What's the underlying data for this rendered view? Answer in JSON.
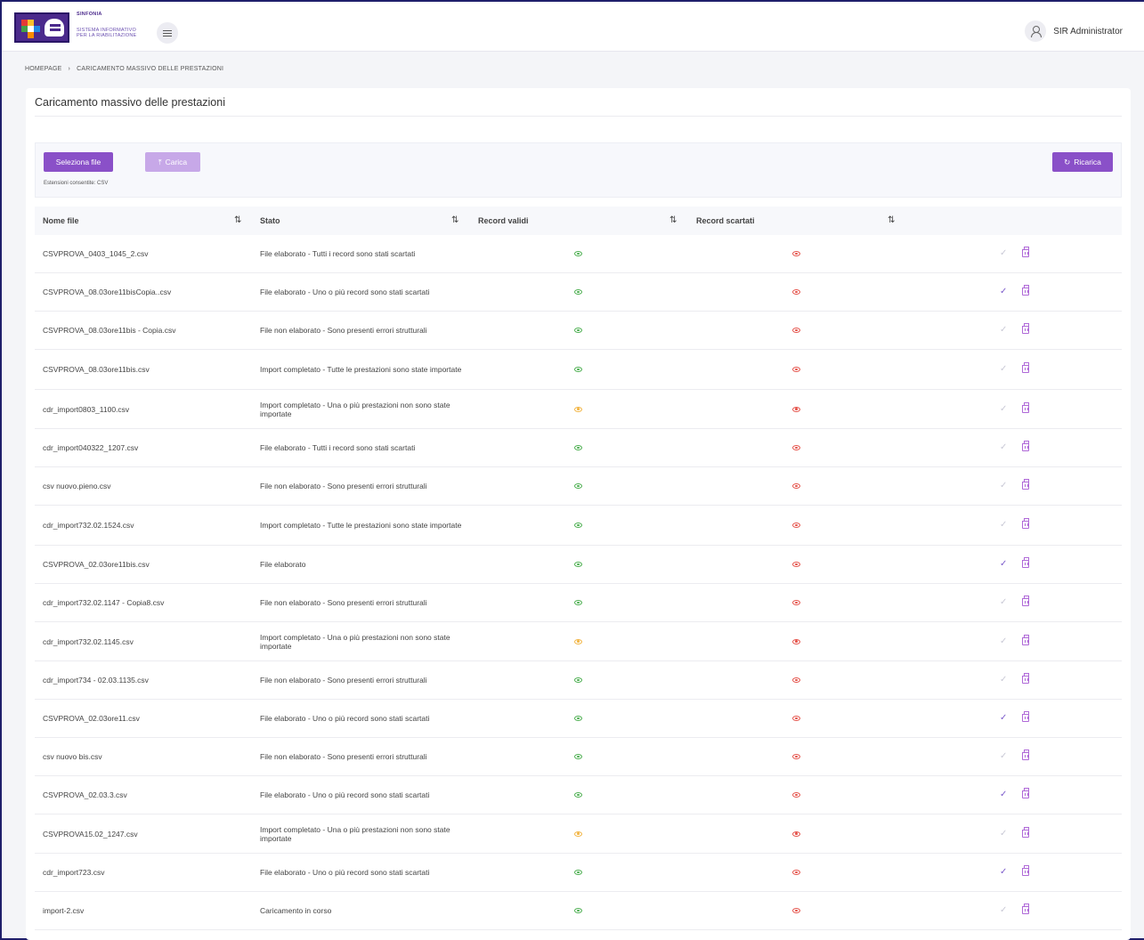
{
  "header": {
    "brand_title": "SINFONIA",
    "brand_subtitle_1": "SISTEMA INFORMATIVO",
    "brand_subtitle_2": "PER LA RIABILITAZIONE",
    "user_name": "SIR Administrator",
    "menu_icon": "hamburger-icon",
    "user_icon": "user-icon"
  },
  "breadcrumb": {
    "home": "HOMEPAGE",
    "separator": "›",
    "current": "CARICAMENTO MASSIVO DELLE PRESTAZIONI"
  },
  "page": {
    "title": "Caricamento massivo delle prestazioni"
  },
  "toolbar": {
    "select_label": "Seleziona file",
    "upload_label": "Carica",
    "upload_icon": "⤒",
    "reload_label": "Ricarica",
    "reload_icon": "↻",
    "extensions_text": "Estensioni consentite: CSV"
  },
  "table": {
    "headers": {
      "name": "Nome file",
      "status": "Stato",
      "valid": "Record validi",
      "discarded": "Record scartati",
      "sort_icon": "⇅"
    },
    "rows": [
      {
        "name": "CSVPROVA_0403_1045_2.csv",
        "status": "File elaborato - Tutti i record sono stati scartati",
        "valid_state": "ok",
        "confirmed": false
      },
      {
        "name": "CSVPROVA_08.03ore11bisCopia..csv",
        "status": "File elaborato - Uno o più record sono stati scartati",
        "valid_state": "ok",
        "confirmed": true
      },
      {
        "name": "CSVPROVA_08.03ore11bis - Copia.csv",
        "status": "File non elaborato - Sono presenti errori strutturali",
        "valid_state": "ok",
        "confirmed": false
      },
      {
        "name": "CSVPROVA_08.03ore11bis.csv",
        "status": "Import completato - Tutte le prestazioni sono state importate",
        "valid_state": "ok",
        "confirmed": false
      },
      {
        "name": "cdr_import0803_1100.csv",
        "status": "Import completato - Una o più prestazioni non sono state importate",
        "valid_state": "warn",
        "confirmed": false
      },
      {
        "name": "cdr_import040322_1207.csv",
        "status": "File elaborato - Tutti i record sono stati scartati",
        "valid_state": "ok",
        "confirmed": false
      },
      {
        "name": "csv nuovo.pieno.csv",
        "status": "File non elaborato - Sono presenti errori strutturali",
        "valid_state": "ok",
        "confirmed": false
      },
      {
        "name": "cdr_import732.02.1524.csv",
        "status": "Import completato - Tutte le prestazioni sono state importate",
        "valid_state": "ok",
        "confirmed": false
      },
      {
        "name": "CSVPROVA_02.03ore11bis.csv",
        "status": "File elaborato",
        "valid_state": "ok",
        "confirmed": true
      },
      {
        "name": "cdr_import732.02.1147 - Copia8.csv",
        "status": "File non elaborato - Sono presenti errori strutturali",
        "valid_state": "ok",
        "confirmed": false
      },
      {
        "name": "cdr_import732.02.1145.csv",
        "status": "Import completato - Una o più prestazioni non sono state importate",
        "valid_state": "warn",
        "confirmed": false
      },
      {
        "name": "cdr_import734 - 02.03.1135.csv",
        "status": "File non elaborato - Sono presenti errori strutturali",
        "valid_state": "ok",
        "confirmed": false
      },
      {
        "name": "CSVPROVA_02.03ore11.csv",
        "status": "File elaborato - Uno o più record sono stati scartati",
        "valid_state": "ok",
        "confirmed": true
      },
      {
        "name": "csv nuovo bis.csv",
        "status": "File non elaborato - Sono presenti errori strutturali",
        "valid_state": "ok",
        "confirmed": false
      },
      {
        "name": "CSVPROVA_02.03.3.csv",
        "status": "File elaborato - Uno o più record sono stati scartati",
        "valid_state": "ok",
        "confirmed": true
      },
      {
        "name": "CSVPROVA15.02_1247.csv",
        "status": "Import completato - Una o più prestazioni non sono state importate",
        "valid_state": "warn",
        "confirmed": false
      },
      {
        "name": "cdr_import723.csv",
        "status": "File elaborato - Uno o più record sono stati scartati",
        "valid_state": "ok",
        "confirmed": true
      },
      {
        "name": "import-2.csv",
        "status": "Caricamento in corso",
        "valid_state": "ok",
        "confirmed": false
      }
    ]
  },
  "colors": {
    "accent": "#8a50c8",
    "valid_ok": "#4caf50",
    "valid_warn": "#f2b544",
    "discarded": "#e5534b"
  }
}
